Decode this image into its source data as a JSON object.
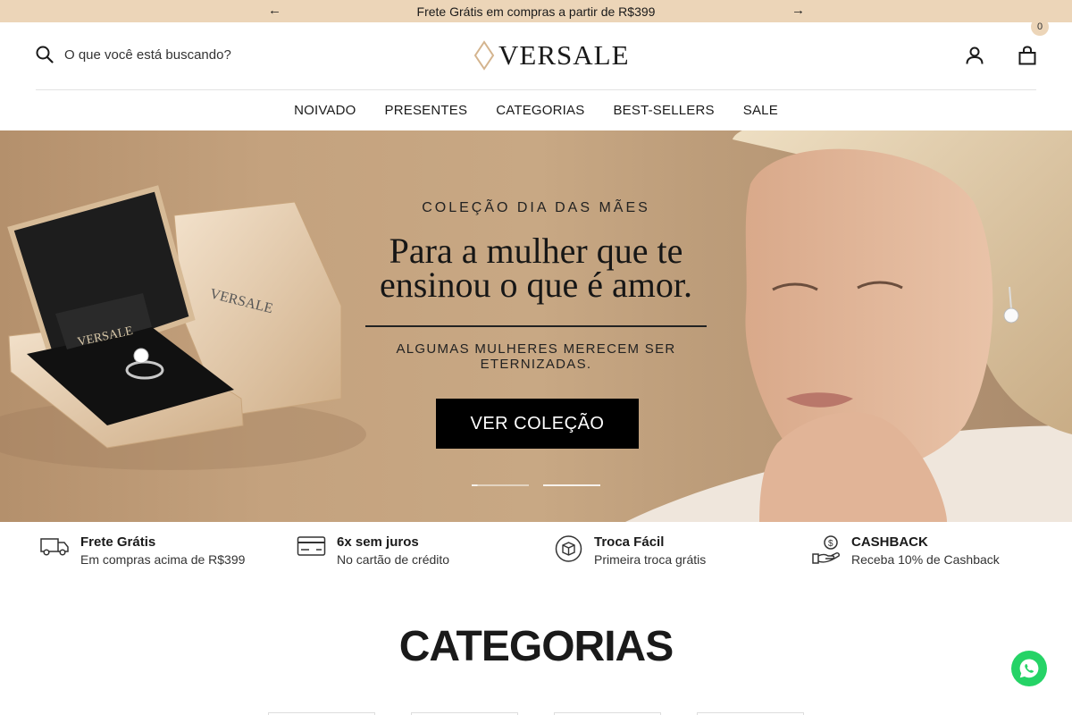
{
  "announcement": {
    "text": "Frete Grátis em compras a partir de R$399",
    "prev_icon": "arrow-left-icon",
    "next_icon": "arrow-right-icon"
  },
  "header": {
    "search_placeholder": "O que você está buscando?",
    "logo_text": "VERSALE",
    "cart_count": "0"
  },
  "nav": {
    "items": [
      "NOIVADO",
      "PRESENTES",
      "CATEGORIAS",
      "BEST-SELLERS",
      "SALE"
    ]
  },
  "hero": {
    "kicker": "COLEÇÃO DIA DAS MÃES",
    "headline_line1": "Para a mulher que te",
    "headline_line2": "ensinou o que é amor.",
    "subtitle": "ALGUMAS MULHERES MERECEM SER ETERNIZADAS.",
    "cta_label": "VER COLEÇÃO",
    "box_brand_front": "VERSALE",
    "box_brand_lid": "VERSALE",
    "slide_count": 2,
    "active_slide": 1
  },
  "features": [
    {
      "icon": "truck-icon",
      "title": "Frete Grátis",
      "desc": "Em compras acima de R$399"
    },
    {
      "icon": "credit-card-icon",
      "title": "6x sem juros",
      "desc": "No cartão de crédito"
    },
    {
      "icon": "box-exchange-icon",
      "title": "Troca Fácil",
      "desc": "Primeira troca grátis"
    },
    {
      "icon": "cashback-hand-icon",
      "title": "CASHBACK",
      "desc": "Receba 10% de Cashback"
    }
  ],
  "categories": {
    "title": "CATEGORIAS"
  },
  "colors": {
    "announcement_bg": "#ecd5b8",
    "cta_bg": "#000000",
    "whatsapp": "#25d366"
  }
}
